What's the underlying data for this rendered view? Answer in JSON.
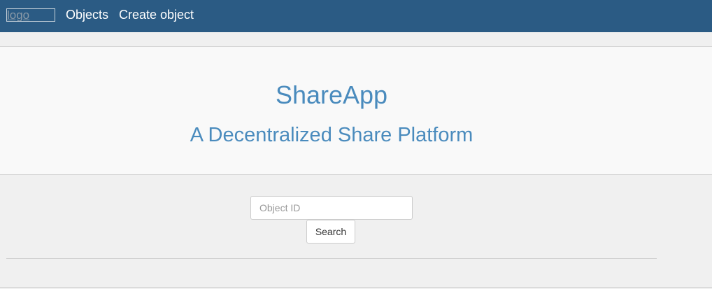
{
  "navbar": {
    "logo_text": "logo",
    "links": [
      {
        "label": "Objects"
      },
      {
        "label": "Create object"
      }
    ],
    "background_color": "#2b5b84"
  },
  "hero": {
    "title": "ShareApp",
    "subtitle": "A Decentralized Share Platform",
    "text_color": "#4a8bbd"
  },
  "search": {
    "placeholder": "Object ID",
    "value": "",
    "button_label": "Search"
  }
}
